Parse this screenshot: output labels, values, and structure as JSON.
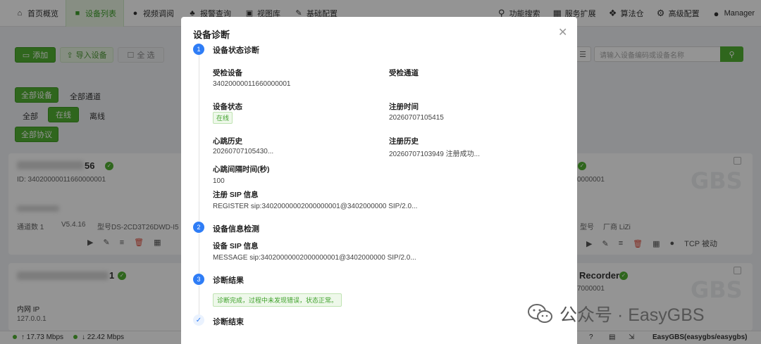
{
  "nav": {
    "items": [
      {
        "label": "首页概览",
        "icon": "home-icon",
        "active": false
      },
      {
        "label": "设备列表",
        "icon": "video-icon",
        "active": true
      },
      {
        "label": "视频调阅",
        "icon": "play-circle-icon",
        "active": false
      },
      {
        "label": "报警查询",
        "icon": "bell-icon",
        "active": false
      },
      {
        "label": "视图库",
        "icon": "image-icon",
        "active": false
      },
      {
        "label": "基础配置",
        "icon": "edit-icon",
        "active": false
      }
    ],
    "right": [
      {
        "label": "功能搜索",
        "icon": "search-icon"
      },
      {
        "label": "服务扩展",
        "icon": "grid-icon"
      },
      {
        "label": "算法仓",
        "icon": "dropbox-icon"
      },
      {
        "label": "高级配置",
        "icon": "gear-icon"
      },
      {
        "label": "Manager",
        "icon": "user-icon"
      }
    ]
  },
  "toolbar": {
    "add_label": "添加",
    "import_label": "导入设备",
    "select_all_label": "全 选",
    "search_placeholder": "请输入设备编码或设备名称"
  },
  "filters": {
    "all_devices": "全部设备",
    "all_channels": "全部通道",
    "all": "全部",
    "online": "在线",
    "offline": "离线",
    "all_protocols": "全部协议"
  },
  "cards": {
    "card1_name_suffix": "56",
    "card1_id": "ID: 34020000011660000001",
    "card1_channels": "通道数 1",
    "card1_version": "V5.4.16",
    "card1_model": "型号DS-2CD3T26DWD-I5",
    "card2_name_suffix": "1",
    "card2_ip_label": "内网 IP",
    "card2_ip": "127.0.0.1",
    "right1_id": "0000001",
    "right1_model": "型号",
    "right1_vendor": "厂商 LiZi",
    "right1_tcp": "TCP 被动",
    "right2_name": "Recorder",
    "right2_id": "7000001",
    "gbs": "GBS"
  },
  "status": {
    "up": "↑ 17.73 Mbps",
    "down": "↓ 22.42 Mbps",
    "user": "EasyGBS(easygbs/easygbs)"
  },
  "dialog": {
    "title": "设备诊断",
    "steps": [
      {
        "num": "1",
        "title": "设备状态诊断"
      },
      {
        "num": "2",
        "title": "设备信息检测"
      },
      {
        "num": "3",
        "title": "诊断结果"
      },
      {
        "num": "✓",
        "title": "诊断结束"
      }
    ],
    "checked_device_label": "受检设备",
    "checked_device_value": "34020000011660000001",
    "checked_channel_label": "受检通道",
    "device_status_label": "设备状态",
    "device_status_value": "在线",
    "register_time_label": "注册时间",
    "register_time_value": "20260707105415",
    "heartbeat_history_label": "心跳历史",
    "heartbeat_history_value": "20260707105430...",
    "register_history_label": "注册历史",
    "register_history_value": "20260707103949 注册成功...",
    "heartbeat_interval_label": "心跳间隔时间(秒)",
    "heartbeat_interval_value": "100",
    "register_sip_label": "注册 SIP 信息",
    "register_sip_value": "REGISTER sip:34020000002000000001@3402000000 SIP/2.0...",
    "device_sip_label": "设备 SIP 信息",
    "device_sip_value": "MESSAGE sip:34020000002000000001@3402000000 SIP/2.0...",
    "result_text": "诊断完成，过程中未发现错误，状态正常。"
  },
  "watermark": {
    "text": "公众号 · EasyGBS"
  }
}
